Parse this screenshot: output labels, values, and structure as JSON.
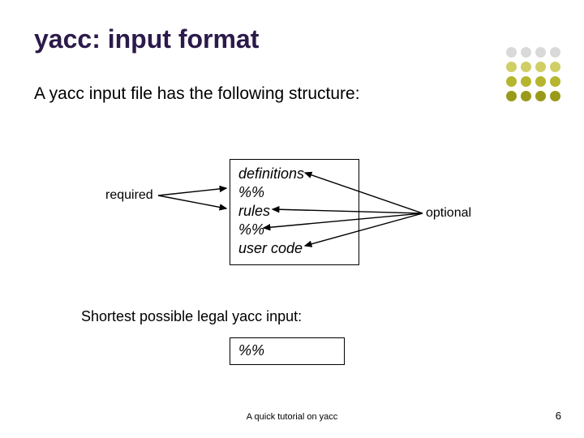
{
  "title": "yacc: input format",
  "subtitle": "A yacc input file has the following structure:",
  "labels": {
    "required": "required",
    "optional": "optional"
  },
  "structure": {
    "line1": "definitions",
    "line2": "%%",
    "line3": "rules",
    "line4": "%%",
    "line5": "user code"
  },
  "shortest_label": "Shortest possible legal yacc input:",
  "shortest_content": "%%",
  "footer": "A quick tutorial on yacc",
  "page_number": "6",
  "dot_colors": {
    "row1": "#d9d9d9",
    "row2": "#cfcf66",
    "row3": "#b5b52f",
    "row4": "#9a9a1a"
  }
}
